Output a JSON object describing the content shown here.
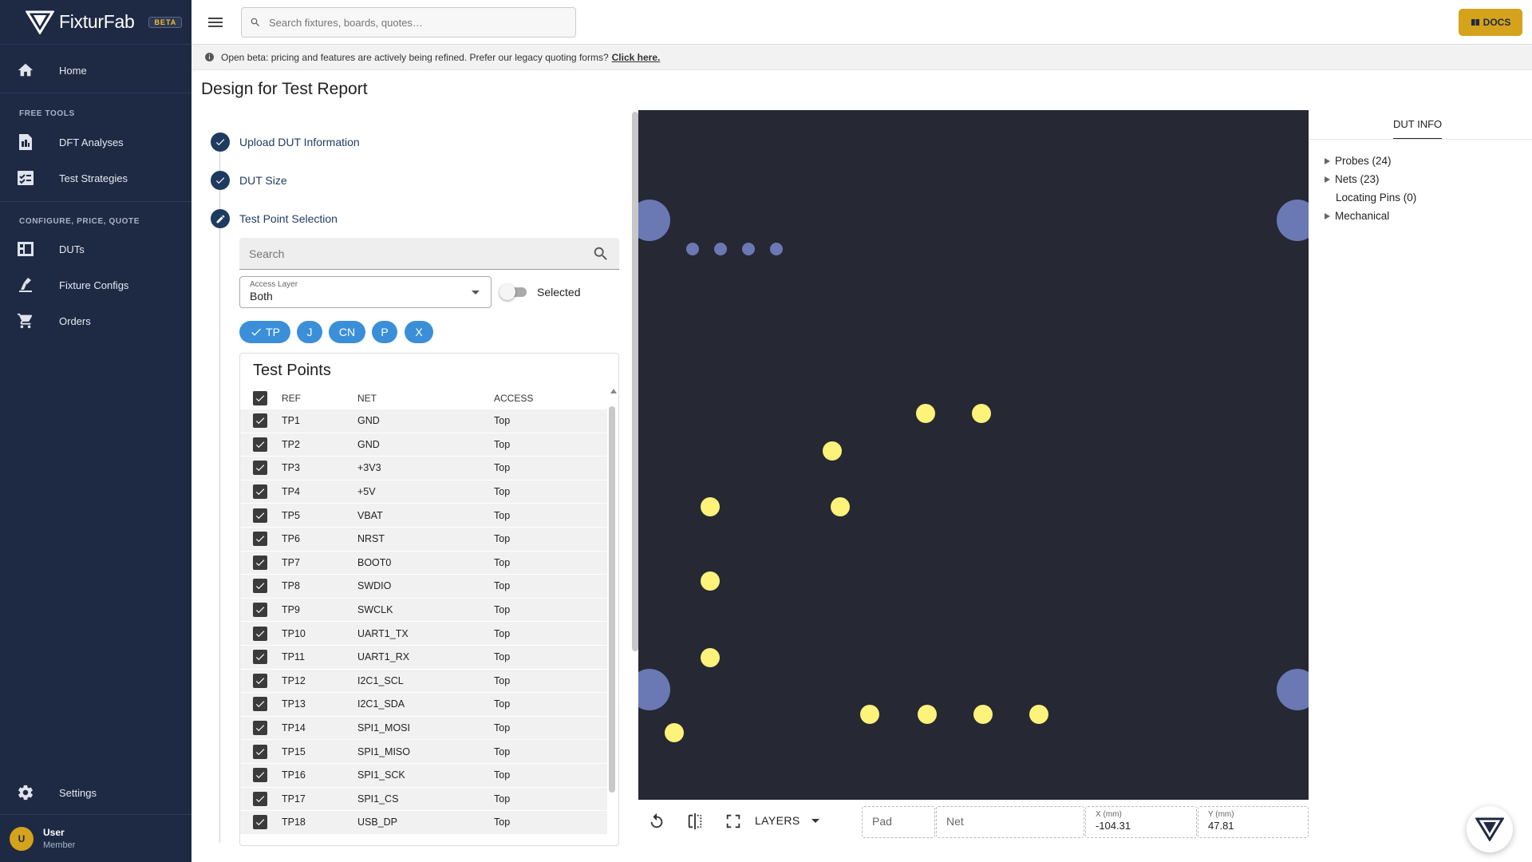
{
  "app": {
    "name": "FixturFab",
    "badge": "BETA"
  },
  "colors": {
    "sidebar_bg": "#1e2a44",
    "accent": "#d4a21b",
    "chip": "#3b8fd9",
    "board_bg": "#262834",
    "test_point": "#fdf27a",
    "mechanical": "#6a78b3",
    "step": "#1e3a5f"
  },
  "sidebar": {
    "home": {
      "label": "Home",
      "icon": "home-icon"
    },
    "section_free_tools": "FREE TOOLS",
    "free_tools": [
      {
        "label": "DFT Analyses",
        "icon": "report-icon"
      },
      {
        "label": "Test Strategies",
        "icon": "checklist-icon"
      }
    ],
    "section_cpq": "CONFIGURE, PRICE, QUOTE",
    "cpq": [
      {
        "label": "DUTs",
        "icon": "board-icon"
      },
      {
        "label": "Fixture Configs",
        "icon": "fixture-icon"
      },
      {
        "label": "Orders",
        "icon": "cart-icon"
      }
    ],
    "settings": {
      "label": "Settings",
      "icon": "gear-icon"
    },
    "user": {
      "initial": "U",
      "name": "User",
      "role": "Member"
    }
  },
  "topbar": {
    "search_placeholder": "Search fixtures, boards, quotes…",
    "docs_label": "DOCS"
  },
  "banner": {
    "text": "Open beta: pricing and features are actively being refined. Prefer our legacy quoting forms?",
    "link": "Click here."
  },
  "page": {
    "title": "Design for Test Report"
  },
  "steps": [
    {
      "label": "Upload DUT Information",
      "state": "done"
    },
    {
      "label": "DUT Size",
      "state": "done"
    },
    {
      "label": "Test Point Selection",
      "state": "active"
    }
  ],
  "test_point_selection": {
    "search_placeholder": "Search",
    "access_layer": {
      "label": "Access Layer",
      "value": "Both"
    },
    "selected_toggle": {
      "label": "Selected",
      "on": false
    },
    "chips": [
      {
        "label": "TP",
        "checked": true
      },
      {
        "label": "J",
        "checked": false
      },
      {
        "label": "CN",
        "checked": false
      },
      {
        "label": "P",
        "checked": false
      },
      {
        "label": "X",
        "checked": false
      }
    ]
  },
  "test_points": {
    "title": "Test Points",
    "columns": [
      "REF",
      "NET",
      "ACCESS"
    ],
    "rows": [
      {
        "ref": "TP1",
        "net": "GND",
        "access": "Top"
      },
      {
        "ref": "TP2",
        "net": "GND",
        "access": "Top"
      },
      {
        "ref": "TP3",
        "net": "+3V3",
        "access": "Top"
      },
      {
        "ref": "TP4",
        "net": "+5V",
        "access": "Top"
      },
      {
        "ref": "TP5",
        "net": "VBAT",
        "access": "Top"
      },
      {
        "ref": "TP6",
        "net": "NRST",
        "access": "Top"
      },
      {
        "ref": "TP7",
        "net": "BOOT0",
        "access": "Top"
      },
      {
        "ref": "TP8",
        "net": "SWDIO",
        "access": "Top"
      },
      {
        "ref": "TP9",
        "net": "SWCLK",
        "access": "Top"
      },
      {
        "ref": "TP10",
        "net": "UART1_TX",
        "access": "Top"
      },
      {
        "ref": "TP11",
        "net": "UART1_RX",
        "access": "Top"
      },
      {
        "ref": "TP12",
        "net": "I2C1_SCL",
        "access": "Top"
      },
      {
        "ref": "TP13",
        "net": "I2C1_SDA",
        "access": "Top"
      },
      {
        "ref": "TP14",
        "net": "SPI1_MOSI",
        "access": "Top"
      },
      {
        "ref": "TP15",
        "net": "SPI1_MISO",
        "access": "Top"
      },
      {
        "ref": "TP16",
        "net": "SPI1_SCK",
        "access": "Top"
      },
      {
        "ref": "TP17",
        "net": "SPI1_CS",
        "access": "Top"
      },
      {
        "ref": "TP18",
        "net": "USB_DP",
        "access": "Top"
      }
    ]
  },
  "viewer": {
    "layers_label": "LAYERS",
    "pad_placeholder": "Pad",
    "net_placeholder": "Net",
    "x_label": "X (mm)",
    "x_value": "-104.31",
    "y_label": "Y (mm)",
    "y_value": "47.81"
  },
  "dut_info": {
    "tab": "DUT INFO",
    "items": [
      {
        "label": "Probes (24)",
        "expandable": true
      },
      {
        "label": "Nets (23)",
        "expandable": true
      },
      {
        "label": "Locating Pins (0)",
        "expandable": false
      },
      {
        "label": "Mechanical",
        "expandable": true
      }
    ]
  }
}
